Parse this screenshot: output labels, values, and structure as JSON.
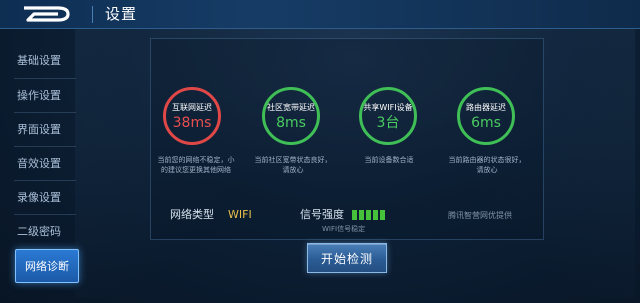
{
  "header": {
    "title": "设置"
  },
  "sidebar": {
    "items": [
      {
        "label": "基础设置"
      },
      {
        "label": "操作设置"
      },
      {
        "label": "界面设置"
      },
      {
        "label": "音效设置"
      },
      {
        "label": "录像设置"
      },
      {
        "label": "二级密码"
      },
      {
        "label": "网络诊断",
        "active": true
      }
    ]
  },
  "diagnostics": [
    {
      "title": "互联网延迟",
      "value": "38ms",
      "status": "red",
      "desc_line1": "当前您的网络不稳定，小",
      "desc_line2": "的建议您更换其他网络"
    },
    {
      "title": "社区宽带延迟",
      "value": "8ms",
      "status": "green",
      "desc_line1": "当前社区宽带状态良好，",
      "desc_line2": "请放心"
    },
    {
      "title": "共享WIFI设备",
      "value": "3台",
      "status": "green",
      "desc_line1": "当前设备数合适",
      "desc_line2": ""
    },
    {
      "title": "路由器延迟",
      "value": "6ms",
      "status": "green",
      "desc_line1": "当前路由器的状态很好，",
      "desc_line2": "请放心"
    }
  ],
  "network": {
    "type_label": "网络类型",
    "type_value": "WIFI",
    "signal_label": "信号强度",
    "signal_bars": 5,
    "signal_note": "WIFI信号稳定",
    "provider": "腾讯智营网优提供"
  },
  "actions": {
    "start_label": "开始检测"
  },
  "colors": {
    "bad": "#e04848",
    "good": "#3fbf56",
    "wifi": "#e6c04a",
    "accent": "#2a7ad4"
  }
}
